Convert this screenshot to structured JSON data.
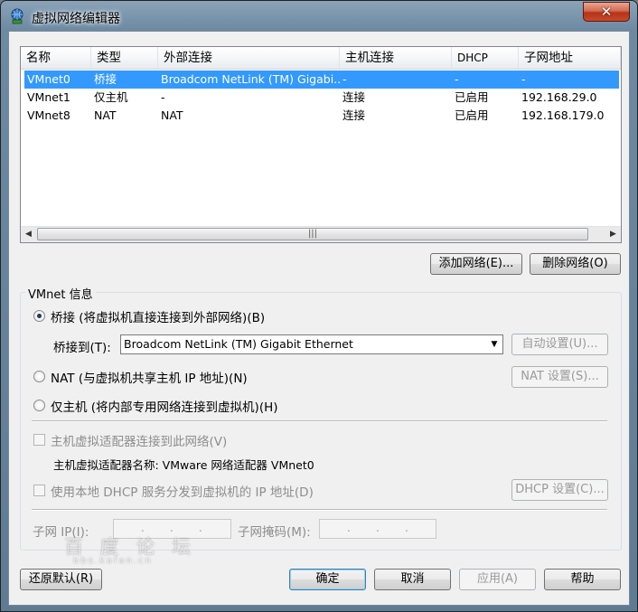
{
  "window": {
    "title": "虚拟网络编辑器",
    "close_label": "✕",
    "title_icon": "network-globe-icon"
  },
  "table": {
    "columns": [
      "名称",
      "类型",
      "外部连接",
      "主机连接",
      "DHCP",
      "子网地址"
    ],
    "rows": [
      {
        "name": "VMnet0",
        "type": "桥接",
        "external": "Broadcom NetLink (TM) Gigabi...",
        "host": "-",
        "dhcp": "-",
        "subnet": "-",
        "selected": true
      },
      {
        "name": "VMnet1",
        "type": "仅主机",
        "external": "-",
        "host": "连接",
        "dhcp": "已启用",
        "subnet": "192.168.29.0",
        "selected": false
      },
      {
        "name": "VMnet8",
        "type": "NAT",
        "external": "NAT",
        "host": "连接",
        "dhcp": "已启用",
        "subnet": "192.168.179.0",
        "selected": false
      }
    ],
    "scroll_left_arrow": "◀",
    "scroll_right_arrow": "▶",
    "scroll_grip": "|||"
  },
  "buttons": {
    "add_network": "添加网络(E)...",
    "remove_network": "删除网络(O)",
    "auto_settings": "自动设置(U)...",
    "nat_settings": "NAT 设置(S)...",
    "dhcp_settings": "DHCP 设置(C)...",
    "restore_defaults": "还原默认(R)",
    "ok": "确定",
    "cancel": "取消",
    "apply": "应用(A)",
    "help": "帮助"
  },
  "vmnet_info": {
    "legend": "VMnet 信息",
    "bridge_radio": "桥接 (将虚拟机直接连接到外部网络)(B)",
    "bridge_to_label": "桥接到(T):",
    "bridge_to_value": "Broadcom NetLink (TM) Gigabit Ethernet",
    "nat_radio": "NAT (与虚拟机共享主机 IP 地址)(N)",
    "hostonly_radio": "仅主机 (将内部专用网络连接到虚拟机)(H)",
    "selected_mode": "bridge",
    "connect_adapter_check": "主机虚拟适配器连接到此网络(V)",
    "adapter_name_label": "主机虚拟适配器名称: VMware 网络适配器 VMnet0",
    "dhcp_check": "使用本地 DHCP 服务分发到虚拟机的 IP 地址(D)",
    "subnet_ip_label": "子网 IP(I):",
    "subnet_mask_label": "子网掩码(M):",
    "ip_dot": "."
  },
  "watermark": {
    "text": "百 度 论 坛",
    "url": "bbs.kafan.cn"
  },
  "colors": {
    "selection": "#3399ff",
    "close_red": "#c9482a",
    "disabled_text": "#8d8d8d"
  }
}
